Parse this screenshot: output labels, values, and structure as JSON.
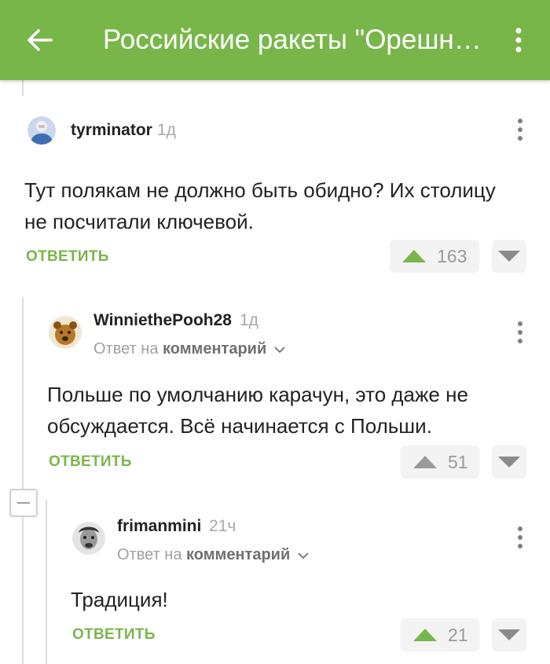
{
  "appbar": {
    "title": "Российские ракеты \"Орешник\" нацелены на...",
    "accent_color": "#79b64a",
    "back_icon": "arrow-left-icon",
    "menu_icon": "more-vertical-icon"
  },
  "comments": [
    {
      "author": "tyrminator",
      "time": "1д",
      "text": "Тут полякам не должно быть обидно? Их столицу не посчитали ключевой.",
      "reply_label": "ОТВЕТИТЬ",
      "votes": "163",
      "upvote_color": "#79b64a"
    },
    {
      "author": "WinniethePooh28",
      "time": "1д",
      "reply_prefix": "Ответ на",
      "reply_target": "комментарий",
      "text": "Польше по умолчанию карачун, это даже не обсуждается. Всё начинается с Польши.",
      "reply_label": "ОТВЕТИТЬ",
      "votes": "51",
      "upvote_color": "#9a9a9a"
    },
    {
      "author": "frimanmini",
      "time": "21ч",
      "reply_prefix": "Ответ на",
      "reply_target": "комментарий",
      "text": "Традиция!",
      "reply_label": "ОТВЕТИТЬ",
      "votes": "21",
      "upvote_color": "#79b64a"
    }
  ]
}
